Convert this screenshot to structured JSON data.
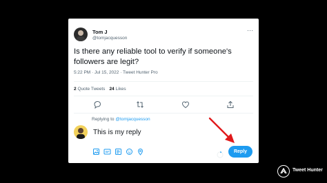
{
  "tweet": {
    "author_name": "Tom J",
    "author_handle": "@tomjacquesson",
    "text": "Is there any reliable tool to verify if someone's followers are legit?",
    "meta": "5:22 PM · Jul 15, 2022 · Tweet Hunter Pro",
    "quote_tweets_count": "2",
    "quote_tweets_label": "Quote Tweets",
    "likes_count": "24",
    "likes_label": "Likes"
  },
  "actions": {
    "icons": [
      "reply-icon",
      "retweet-icon",
      "like-icon",
      "share-icon"
    ]
  },
  "reply": {
    "context_prefix": "Replying to",
    "context_mention": "@tomjacquesson",
    "text": "This is my reply",
    "button_label": "Reply",
    "tool_icons": [
      "image-icon",
      "gif-icon",
      "poll-icon",
      "emoji-icon",
      "location-icon"
    ]
  },
  "brand": {
    "name": "Tweet Hunter"
  },
  "colors": {
    "background": "#000000",
    "card": "#ffffff",
    "accent": "#1d9bf0",
    "arrow": "#e0191b",
    "secondary_text": "#536471"
  }
}
